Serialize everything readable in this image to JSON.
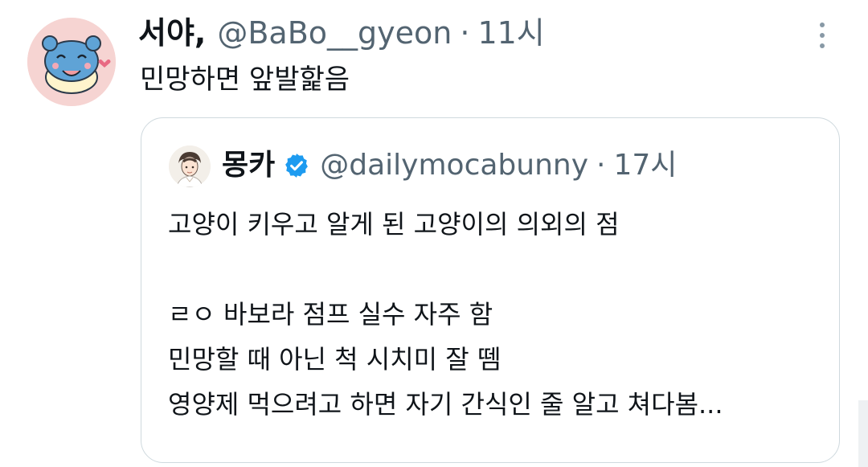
{
  "tweet": {
    "display_name": "서야,",
    "handle": "@BaBo__gyeon",
    "separator": "·",
    "time": "11시",
    "text": "민망하면 앞발핥음",
    "avatar_icon": "blue-cartoon-creature-avatar",
    "more_icon": "more-vertical-icon"
  },
  "quote": {
    "display_name": "몽카",
    "verified_icon": "verified-badge-icon",
    "verified_color": "#1d9bf0",
    "handle": "@dailymocabunny",
    "separator": "·",
    "time": "17시",
    "avatar_icon": "illustrated-person-avatar",
    "lines": [
      "고양이 키우고 알게 된 고양이의 의외의 점",
      "",
      "ㄹㅇ 바보라 점프 실수 자주 함",
      "민망할 때 아닌 척 시치미 잘 뗌",
      "영양제 먹으려고 하면 자기 간식인 줄 알고 쳐다봄..."
    ]
  }
}
